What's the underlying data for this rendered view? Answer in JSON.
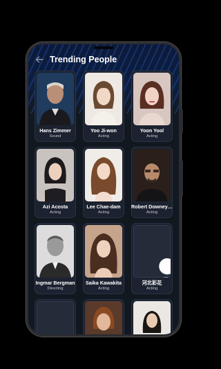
{
  "header": {
    "title": "Trending People"
  },
  "people": [
    {
      "name": "Hans Zimmer",
      "department": "Sound"
    },
    {
      "name": "Yoo Ji-won",
      "department": "Acting"
    },
    {
      "name": "Yoon Yool",
      "department": "Acting"
    },
    {
      "name": "Azi Acosta",
      "department": "Acting"
    },
    {
      "name": "Lee Chae-dam",
      "department": "Acting"
    },
    {
      "name": "Robert Downey Jr.",
      "department": "Acting"
    },
    {
      "name": "Ingmar Bergman",
      "department": "Directing"
    },
    {
      "name": "Saika Kawakita",
      "department": "Acting"
    },
    {
      "name": "河北彩花",
      "department": "Acting"
    },
    {
      "name": "",
      "department": ""
    },
    {
      "name": "",
      "department": ""
    },
    {
      "name": "",
      "department": ""
    }
  ],
  "icons": {
    "back": "back-arrow-icon",
    "placeholder": "user-silhouette-icon"
  },
  "colors": {
    "background": "#121820",
    "card": "#1c2230",
    "header_accent": "#0d1e40"
  }
}
